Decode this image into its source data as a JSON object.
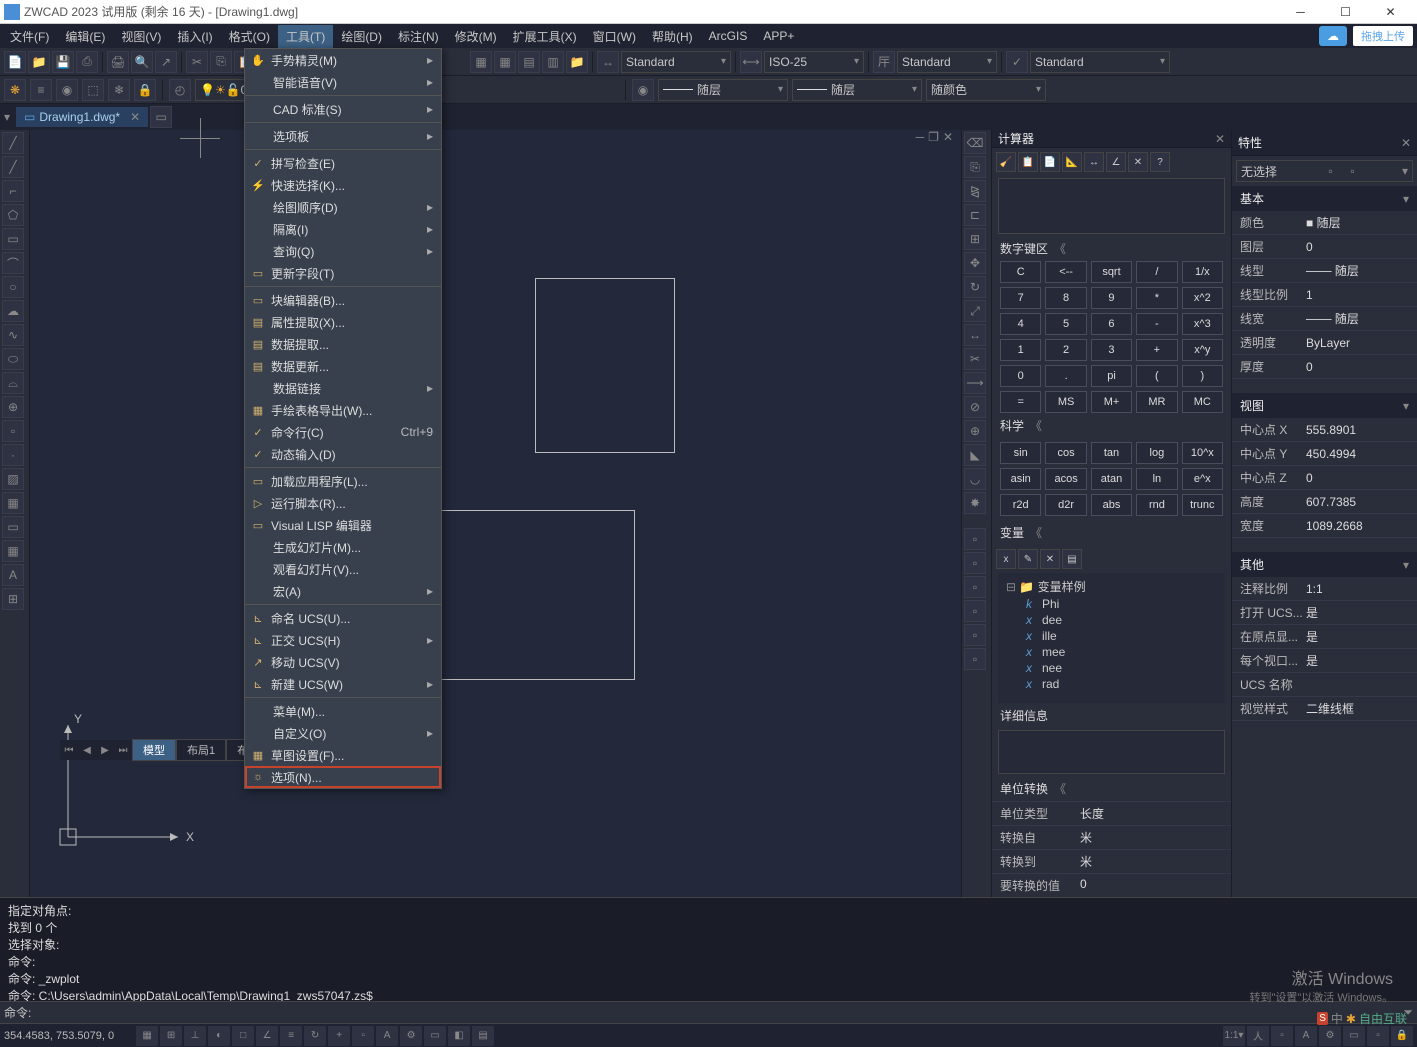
{
  "title": "ZWCAD 2023 试用版 (剩余 16 天) - [Drawing1.dwg]",
  "upload_btn": "拖拽上传",
  "menu": [
    "文件(F)",
    "编辑(E)",
    "视图(V)",
    "插入(I)",
    "格式(O)",
    "工具(T)",
    "绘图(D)",
    "标注(N)",
    "修改(M)",
    "扩展工具(X)",
    "窗口(W)",
    "帮助(H)",
    "ArcGIS",
    "APP+"
  ],
  "active_menu": 5,
  "toolbar_combos": {
    "std1": "Standard",
    "iso": "ISO-25",
    "std2": "Standard",
    "std3": "Standard"
  },
  "layer": {
    "c1": "0",
    "linetype": "随层",
    "lineweight": "随层",
    "color": "随颜色"
  },
  "filetab": "Drawing1.dwg*",
  "dropdown": [
    {
      "t": "手势精灵(M)",
      "a": 1,
      "i": "✋"
    },
    {
      "t": "智能语音(V)",
      "a": 1
    },
    {
      "sep": 1
    },
    {
      "t": "CAD 标准(S)",
      "a": 1
    },
    {
      "sep": 1
    },
    {
      "t": "选项板",
      "a": 1
    },
    {
      "sep": 1
    },
    {
      "t": "拼写检查(E)",
      "i": "✓"
    },
    {
      "t": "快速选择(K)...",
      "i": "⚡"
    },
    {
      "t": "绘图顺序(D)",
      "a": 1
    },
    {
      "t": "隔离(I)",
      "a": 1
    },
    {
      "t": "查询(Q)",
      "a": 1
    },
    {
      "t": "更新字段(T)",
      "i": "▭"
    },
    {
      "sep": 1
    },
    {
      "t": "块编辑器(B)...",
      "i": "▭"
    },
    {
      "t": "属性提取(X)...",
      "i": "▤"
    },
    {
      "t": "数据提取...",
      "i": "▤"
    },
    {
      "t": "数据更新...",
      "i": "▤"
    },
    {
      "t": "数据链接",
      "a": 1
    },
    {
      "t": "手绘表格导出(W)...",
      "i": "▦"
    },
    {
      "t": "命令行(C)",
      "sc": "Ctrl+9",
      "i": "✓"
    },
    {
      "t": "动态输入(D)",
      "i": "✓"
    },
    {
      "sep": 1
    },
    {
      "t": "加载应用程序(L)...",
      "i": "▭"
    },
    {
      "t": "运行脚本(R)...",
      "i": "▷"
    },
    {
      "t": "Visual LISP 编辑器",
      "i": "▭"
    },
    {
      "t": "生成幻灯片(M)..."
    },
    {
      "t": "观看幻灯片(V)..."
    },
    {
      "t": "宏(A)",
      "a": 1
    },
    {
      "sep": 1
    },
    {
      "t": "命名 UCS(U)...",
      "i": "⊾"
    },
    {
      "t": "正交 UCS(H)",
      "a": 1,
      "i": "⊾"
    },
    {
      "t": "移动 UCS(V)",
      "i": "↗"
    },
    {
      "t": "新建 UCS(W)",
      "a": 1,
      "i": "⊾"
    },
    {
      "sep": 1
    },
    {
      "t": "菜单(M)..."
    },
    {
      "t": "自定义(O)",
      "a": 1
    },
    {
      "t": "草图设置(F)...",
      "i": "▦"
    },
    {
      "t": "选项(N)...",
      "hl": 1,
      "i": "☼"
    }
  ],
  "calc": {
    "title": "计算器",
    "numhdr": "数字键区",
    "keys": [
      [
        "C",
        "<--",
        "sqrt",
        "/",
        "1/x"
      ],
      [
        "7",
        "8",
        "9",
        "*",
        "x^2"
      ],
      [
        "4",
        "5",
        "6",
        "-",
        "x^3"
      ],
      [
        "1",
        "2",
        "3",
        "+",
        "x^y"
      ],
      [
        "0",
        ".",
        "pi",
        "(",
        ")"
      ],
      [
        "=",
        "MS",
        "M+",
        "MR",
        "MC"
      ]
    ],
    "scihdr": "科学",
    "sci": [
      [
        "sin",
        "cos",
        "tan",
        "log",
        "10^x"
      ],
      [
        "asin",
        "acos",
        "atan",
        "ln",
        "e^x"
      ],
      [
        "r2d",
        "d2r",
        "abs",
        "rnd",
        "trunc"
      ]
    ],
    "varhdr": "变量",
    "varroot": "变量样例",
    "vars": [
      [
        "k",
        "Phi"
      ],
      [
        "x",
        "dee"
      ],
      [
        "x",
        "ille"
      ],
      [
        "x",
        "mee"
      ],
      [
        "x",
        "nee"
      ],
      [
        "x",
        "rad"
      ]
    ],
    "detail": "详细信息",
    "unithdr": "单位转换",
    "unit": [
      [
        "单位类型",
        "长度"
      ],
      [
        "转换自",
        "米"
      ],
      [
        "转换到",
        "米"
      ],
      [
        "要转换的值",
        "0"
      ]
    ]
  },
  "props": {
    "title": "特性",
    "sel": "无选择",
    "basic_hdr": "基本",
    "basic": [
      [
        "颜色",
        "■ 随层"
      ],
      [
        "图层",
        "0"
      ],
      [
        "线型",
        "─── 随层"
      ],
      [
        "线型比例",
        "1"
      ],
      [
        "线宽",
        "─── 随层"
      ],
      [
        "透明度",
        "ByLayer"
      ],
      [
        "厚度",
        "0"
      ]
    ],
    "view_hdr": "视图",
    "view": [
      [
        "中心点 X",
        "555.8901"
      ],
      [
        "中心点 Y",
        "450.4994"
      ],
      [
        "中心点 Z",
        "0"
      ],
      [
        "高度",
        "607.7385"
      ],
      [
        "宽度",
        "1089.2668"
      ]
    ],
    "other_hdr": "其他",
    "other": [
      [
        "注释比例",
        "1:1"
      ],
      [
        "打开 UCS...",
        "是"
      ],
      [
        "在原点显...",
        "是"
      ],
      [
        "每个视口...",
        "是"
      ],
      [
        "UCS 名称",
        ""
      ],
      [
        "视觉样式",
        "二维线框"
      ]
    ]
  },
  "model_tabs": [
    "模型",
    "布局1",
    "布局2"
  ],
  "cmd": {
    "lines": [
      "指定对角点:",
      "找到 0 个",
      "选择对象:",
      "命令:",
      "命令: _zwplot",
      "命令: C:\\Users\\admin\\AppData\\Local\\Temp\\Drawing1_zws57047.zs$"
    ],
    "prompt": "命令:"
  },
  "status": {
    "coords": "354.4583, 753.5079, 0"
  },
  "watermark": {
    "l1": "激活 Windows",
    "l2": "转到\"设置\"以激活 Windows。"
  },
  "brand": "自由互联"
}
